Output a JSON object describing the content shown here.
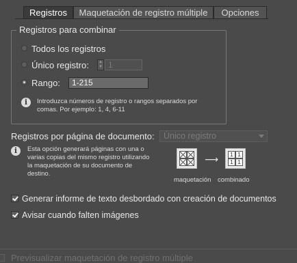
{
  "tabs": [
    {
      "label": "Registros",
      "active": true
    },
    {
      "label": "Maquetación de registro múltiple",
      "active": false
    },
    {
      "label": "Opciones",
      "active": false
    }
  ],
  "records_group": {
    "title": "Registros para combinar",
    "all_records_label": "Todos los registros",
    "single_record_label": "Único registro:",
    "single_record_value": "1",
    "range_label": "Rango:",
    "range_value": "1-215",
    "selected": "range",
    "info_text_line1": "Introduzca números de registro o rangos separados por",
    "info_text_line2": "comas. Por ejemplo: 1, 4, 6-11"
  },
  "per_page": {
    "label": "Registros por página de documento:",
    "selected_value": "Único registro",
    "info_line1": "Esta opción generará páginas con una o",
    "info_line2": "varias copias del mismo registro utilizando",
    "info_line3": "la maquetación de su documento de",
    "info_line4": "destino.",
    "layout_caption": "maquetación",
    "combined_caption": "combinado",
    "arrow_glyph": "⟶",
    "combined_digit": "1"
  },
  "options": {
    "overset_report_label": "Generar informe de texto desbordado con creación de documentos",
    "overset_report_checked": true,
    "missing_images_label": "Avisar cuando falten imágenes",
    "missing_images_checked": true
  },
  "footer": {
    "preview_label": "Previsualizar maquetación de registro múltiple",
    "preview_checked": false,
    "preview_enabled": false
  },
  "icons": {
    "info": "info-icon",
    "layout": "layout-grid-icon",
    "combined": "combined-grid-icon"
  },
  "colors": {
    "panel_bg": "#4a4a4a",
    "active_tab_bg": "#3b3b3b",
    "text": "#e6e6e6",
    "disabled_text": "#7a7a7a"
  }
}
